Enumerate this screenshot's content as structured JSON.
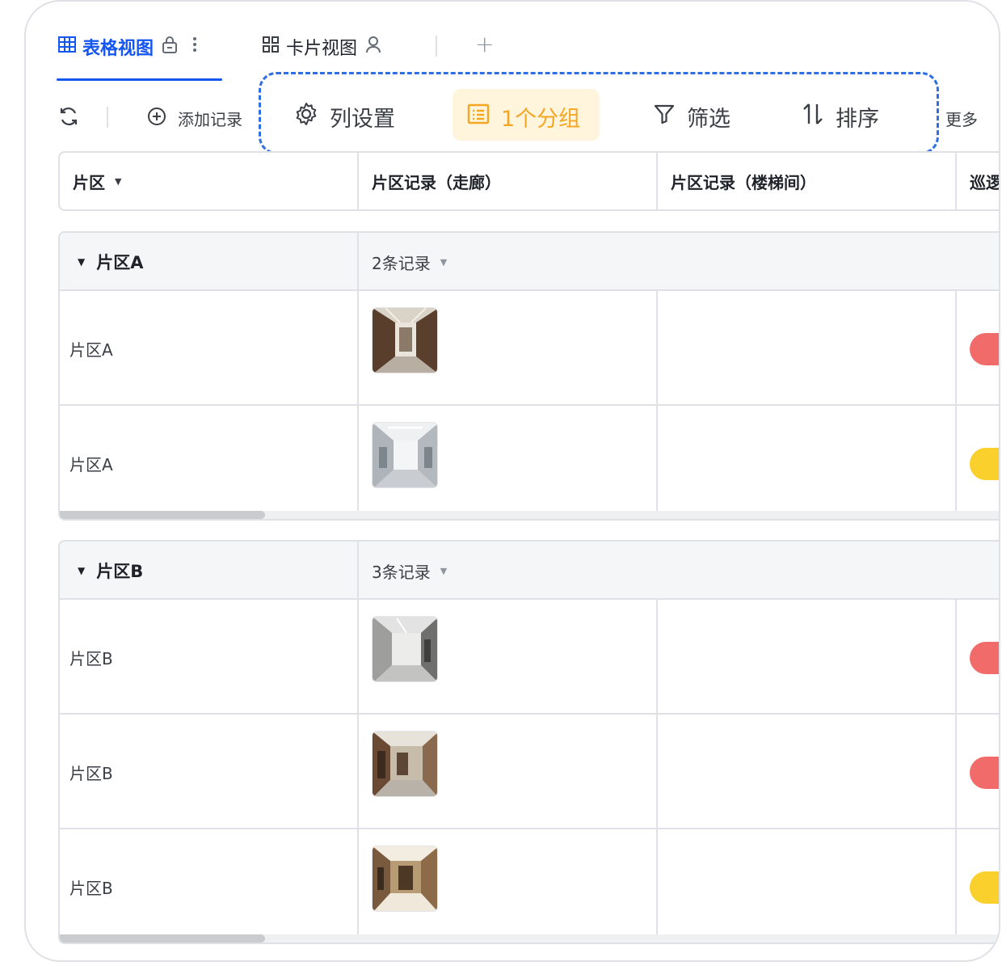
{
  "tabs": {
    "table_view": "表格视图",
    "card_view": "卡片视图",
    "add": "+"
  },
  "toolbar": {
    "add_record": "添加记录",
    "column_settings": "列设置",
    "group": "1个分组",
    "filter": "筛选",
    "sort": "排序",
    "more": "更多"
  },
  "columns": {
    "zone": "片区",
    "corridor": "片区记录（走廊）",
    "stairwell": "片区记录（楼梯间）",
    "patrol": "巡逻"
  },
  "groups": [
    {
      "name": "片区A",
      "count": "2条记录",
      "rows": [
        {
          "zone": "片区A",
          "status_color": "#f26b6b"
        },
        {
          "zone": "片区A",
          "status_color": "#fad02c"
        }
      ]
    },
    {
      "name": "片区B",
      "count": "3条记录",
      "rows": [
        {
          "zone": "片区B",
          "status_color": "#f26b6b"
        },
        {
          "zone": "片区B",
          "status_color": "#f26b6b"
        },
        {
          "zone": "片区B",
          "status_color": "#fad02c"
        }
      ]
    }
  ],
  "colors": {
    "accent": "#1456f0",
    "group_highlight": "#f5a623",
    "dashed_outline": "#2f6fe4"
  }
}
